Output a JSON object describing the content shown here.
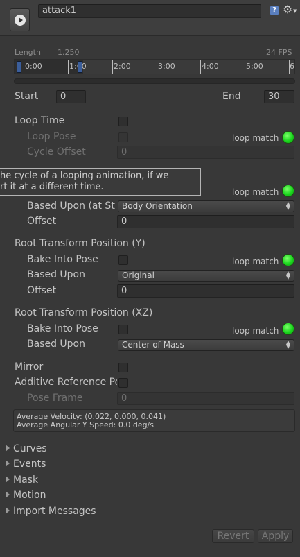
{
  "header": {
    "clip_name": "attack1",
    "play_icon": "play-icon",
    "help_icon": "help-icon",
    "settings_icon": "gear-icon"
  },
  "timeline": {
    "length_label": "Length",
    "length_value": "1.250",
    "fps": "24 FPS",
    "ticks": [
      "0:00",
      "1:00",
      "2:00",
      "3:00",
      "4:00",
      "5:00",
      "6"
    ]
  },
  "range": {
    "start_label": "Start",
    "start_value": "0",
    "end_label": "End",
    "end_value": "30"
  },
  "loop": {
    "loop_time": "Loop Time",
    "loop_pose": "Loop Pose",
    "loop_match": "loop match",
    "cycle_offset": "Cycle Offset",
    "cycle_offset_value": "0"
  },
  "tooltip": {
    "line1": "he cycle of a looping animation, if we",
    "line2": "rt it at a different time."
  },
  "rotation": {
    "loop_match": "loop match",
    "based_upon_label": "Based Upon (at Start)",
    "based_upon_value": "Body Orientation",
    "offset_label": "Offset",
    "offset_value": "0"
  },
  "position_y": {
    "title": "Root Transform Position (Y)",
    "bake_label": "Bake Into Pose",
    "loop_match": "loop match",
    "based_upon_label": "Based Upon",
    "based_upon_value": "Original",
    "offset_label": "Offset",
    "offset_value": "0"
  },
  "position_xz": {
    "title": "Root Transform Position (XZ)",
    "bake_label": "Bake Into Pose",
    "loop_match": "loop match",
    "based_upon_label": "Based Upon",
    "based_upon_value": "Center of Mass"
  },
  "misc": {
    "mirror": "Mirror",
    "additive": "Additive Reference Pose",
    "pose_frame": "Pose Frame",
    "pose_frame_value": "0"
  },
  "info": {
    "velocity": "Average Velocity: (0.022, 0.000, 0.041)",
    "angular": "Average Angular Y Speed: 0.0 deg/s"
  },
  "foldouts": [
    "Curves",
    "Events",
    "Mask",
    "Motion",
    "Import Messages"
  ],
  "buttons": {
    "revert": "Revert",
    "apply": "Apply"
  },
  "colors": {
    "background": "#383838",
    "header": "#3e3e3e",
    "loop_match_green": "#19d51c"
  }
}
